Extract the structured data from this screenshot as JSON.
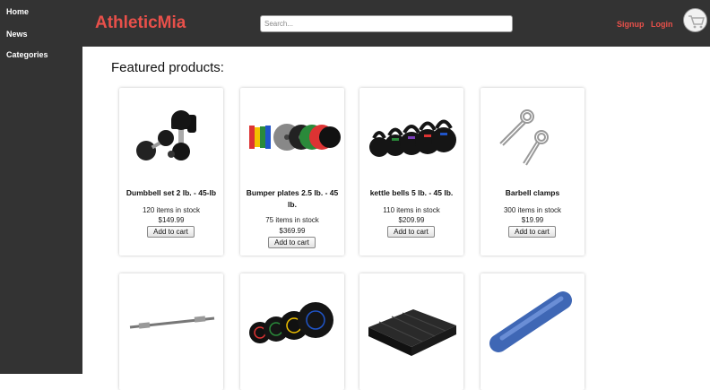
{
  "sidebar": {
    "items": [
      {
        "label": "Home"
      },
      {
        "label": "News"
      },
      {
        "label": "Categories"
      }
    ]
  },
  "header": {
    "brand": "AthleticMia",
    "search_placeholder": "Search...",
    "signup_label": "Signup",
    "login_label": "Login",
    "cart_icon": "shopping-cart-icon",
    "brand_color": "#e8504a"
  },
  "main": {
    "heading": "Featured products:",
    "products": [
      {
        "name": "Dumbbell set 2 lb. - 45-lb",
        "stock": "120 items in stock",
        "price": "$149.99",
        "button": "Add to cart"
      },
      {
        "name": "Bumper plates 2.5 lb. - 45 lb.",
        "stock": "75 items in stock",
        "price": "$369.99",
        "button": "Add to cart"
      },
      {
        "name": "kettle bells 5 lb. - 45 lb.",
        "stock": "110 items in stock",
        "price": "$209.99",
        "button": "Add to cart"
      },
      {
        "name": "Barbell clamps",
        "stock": "300 items in stock",
        "price": "$19.99",
        "button": "Add to cart"
      }
    ]
  }
}
